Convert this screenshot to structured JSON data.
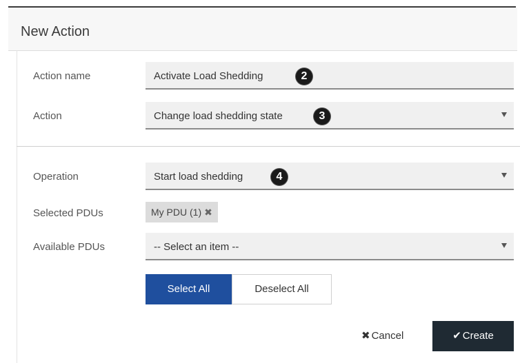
{
  "dialog": {
    "title": "New Action"
  },
  "form": {
    "action_name": {
      "label": "Action name",
      "value": "Activate Load Shedding",
      "marker": "2"
    },
    "action": {
      "label": "Action",
      "value": "Change load shedding state",
      "marker": "3"
    },
    "operation": {
      "label": "Operation",
      "value": "Start load shedding",
      "marker": "4"
    },
    "selected_pdus": {
      "label": "Selected PDUs",
      "chips": [
        "My PDU (1)"
      ],
      "remove_glyph": "✖"
    },
    "available_pdus": {
      "label": "Available PDUs",
      "value": "-- Select an item --"
    }
  },
  "buttons": {
    "select_all": "Select All",
    "deselect_all": "Deselect All",
    "cancel": "Cancel",
    "cancel_glyph": "✖",
    "create": "Create",
    "create_glyph": "✔"
  },
  "colors": {
    "primary": "#1f4f9e",
    "create_bg": "#1f2a33",
    "field_bg": "#f0f0f0"
  }
}
